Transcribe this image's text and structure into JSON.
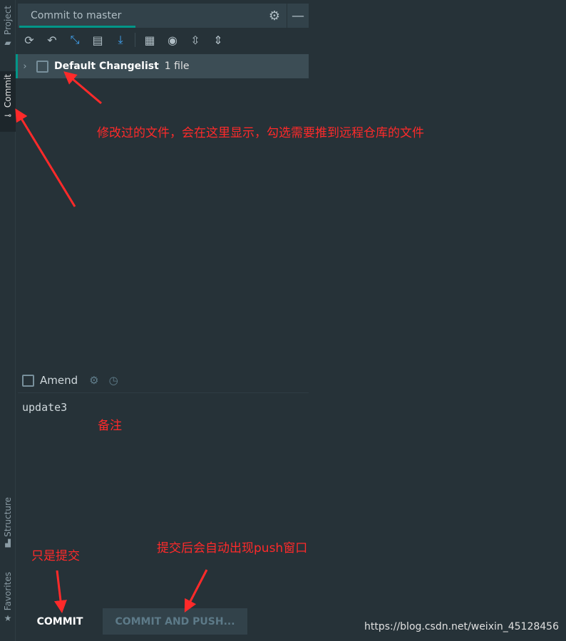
{
  "sidebar": {
    "tabs": [
      {
        "label": "Project",
        "icon": "folder-icon"
      },
      {
        "label": "Commit",
        "icon": "commit-icon",
        "active": true
      },
      {
        "label": "Structure",
        "icon": "structure-icon"
      },
      {
        "label": "Favorites",
        "icon": "star-icon"
      }
    ]
  },
  "header": {
    "tab_title": "Commit to master"
  },
  "toolbar": {
    "icons": [
      "refresh-icon",
      "rollback-icon",
      "diff-icon",
      "changelist-icon",
      "update-icon",
      "group-by-icon",
      "view-options-icon",
      "expand-all-icon",
      "collapse-all-icon"
    ]
  },
  "changelist": {
    "name": "Default Changelist",
    "count": "1 file"
  },
  "amend": {
    "label": "Amend"
  },
  "commit_message": "update3",
  "buttons": {
    "commit": "COMMIT",
    "commit_push": "COMMIT AND PUSH..."
  },
  "annotations": {
    "files": "修改过的文件，会在这里显示，勾选需要推到远程仓库的文件",
    "note": "备注",
    "commit_only": "只是提交",
    "push": "提交后会自动出现push窗口"
  },
  "watermark": "https://blog.csdn.net/weixin_45128456",
  "colors": {
    "accent": "#009688",
    "annotation": "#ff2a2a",
    "background": "#263238"
  }
}
